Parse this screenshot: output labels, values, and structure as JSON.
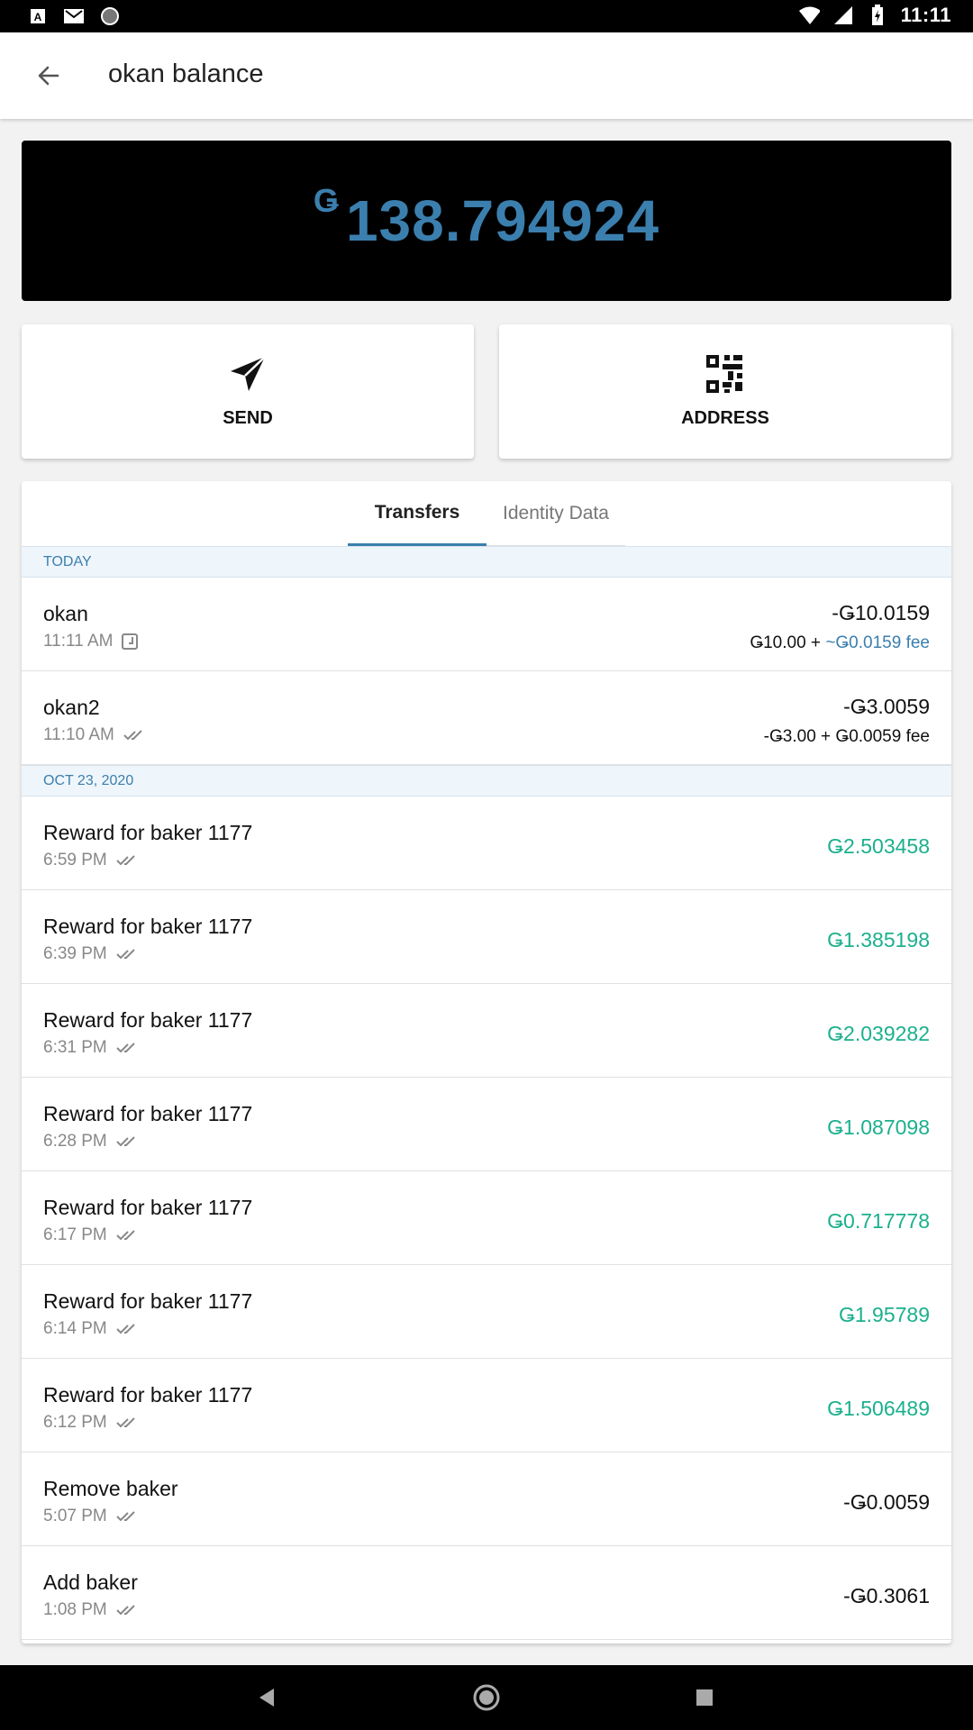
{
  "status_bar": {
    "time": "11:11",
    "left_icons": [
      "a-icon",
      "gmail-icon",
      "circle-icon"
    ],
    "right_icons": [
      "wifi-icon",
      "signal-icon",
      "battery-icon"
    ]
  },
  "app_bar": {
    "title": "okan balance"
  },
  "balance": {
    "currency_symbol": "Ǥ",
    "amount": "138.794924"
  },
  "actions": {
    "send_label": "SEND",
    "address_label": "ADDRESS"
  },
  "tabs": [
    {
      "label": "Transfers",
      "active": true
    },
    {
      "label": "Identity Data",
      "active": false
    }
  ],
  "sections": [
    {
      "header": "TODAY",
      "rows": [
        {
          "name": "okan",
          "time": "11:11 AM",
          "status_icon": "clock-icon",
          "amount": "-Ǥ10.0159",
          "fee_base": "Ǥ10.00 + ",
          "fee_extra": "~Ǥ0.0159 fee"
        },
        {
          "name": "okan2",
          "time": "11:10 AM",
          "status_icon": "double-check-icon",
          "amount": "-Ǥ3.0059",
          "fee_base": "-Ǥ3.00 + Ǥ0.0059 fee",
          "fee_extra": ""
        }
      ]
    },
    {
      "header": "OCT 23, 2020",
      "rows": [
        {
          "name": "Reward for baker 1177",
          "time": "6:59 PM",
          "status_icon": "double-check-icon",
          "amount": "Ǥ2.503458"
        },
        {
          "name": "Reward for baker 1177",
          "time": "6:39 PM",
          "status_icon": "double-check-icon",
          "amount": "Ǥ1.385198"
        },
        {
          "name": "Reward for baker 1177",
          "time": "6:31 PM",
          "status_icon": "double-check-icon",
          "amount": "Ǥ2.039282"
        },
        {
          "name": "Reward for baker 1177",
          "time": "6:28 PM",
          "status_icon": "double-check-icon",
          "amount": "Ǥ1.087098"
        },
        {
          "name": "Reward for baker 1177",
          "time": "6:17 PM",
          "status_icon": "double-check-icon",
          "amount": "Ǥ0.717778"
        },
        {
          "name": "Reward for baker 1177",
          "time": "6:14 PM",
          "status_icon": "double-check-icon",
          "amount": "Ǥ1.95789"
        },
        {
          "name": "Reward for baker 1177",
          "time": "6:12 PM",
          "status_icon": "double-check-icon",
          "amount": "Ǥ1.506489"
        },
        {
          "name": "Remove baker",
          "time": "5:07 PM",
          "status_icon": "double-check-icon",
          "amount": "-Ǥ0.0059"
        },
        {
          "name": "Add baker",
          "time": "1:08 PM",
          "status_icon": "double-check-icon",
          "amount": "-Ǥ0.3061"
        }
      ]
    }
  ],
  "colors": {
    "accent": "#3b7fae",
    "positive": "#1bb08d",
    "section_bg": "#eef5fb"
  }
}
